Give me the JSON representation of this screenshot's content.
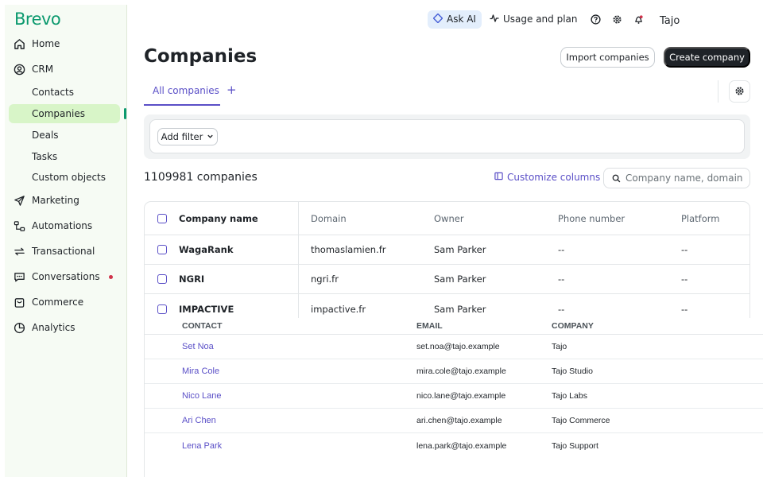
{
  "brand": {
    "logo": "Brevo"
  },
  "sidebar": {
    "items": [
      {
        "label": "Home",
        "icon": "home-icon"
      },
      {
        "label": "CRM",
        "icon": "user-circle-icon"
      },
      {
        "label": "Marketing",
        "icon": "send-icon"
      },
      {
        "label": "Automations",
        "icon": "automation-icon"
      },
      {
        "label": "Transactional",
        "icon": "repeat-icon"
      },
      {
        "label": "Conversations",
        "icon": "chat-icon"
      },
      {
        "label": "Commerce",
        "icon": "bag-icon"
      },
      {
        "label": "Analytics",
        "icon": "pie-chart-icon"
      }
    ],
    "crm_sub": [
      "Contacts",
      "Companies",
      "Deals",
      "Tasks",
      "Custom objects"
    ],
    "active_sub": "Companies"
  },
  "topbar": {
    "ask_ai": "Ask AI",
    "usage": "Usage and plan",
    "user": "Tajo"
  },
  "header": {
    "title": "Companies",
    "import_label": "Import companies",
    "create_label": "Create company"
  },
  "tabs": {
    "all": "All companies",
    "add": "+"
  },
  "filter": {
    "add_label": "Add filter"
  },
  "list": {
    "count": "1109981 companies",
    "customize": "Customize columns",
    "search_placeholder": "Company name, domain"
  },
  "table": {
    "columns": [
      "Company name",
      "Domain",
      "Owner",
      "Phone number",
      "Platform"
    ],
    "rows": [
      {
        "name": "WagaRank",
        "domain": "thomaslamien.fr",
        "owner": "Sam Parker",
        "phone": "--",
        "platform": "--"
      },
      {
        "name": "NGRI",
        "domain": "ngri.fr",
        "owner": "Sam Parker",
        "phone": "--",
        "platform": "--"
      },
      {
        "name": "IMPACTIVE",
        "domain": "impactive.fr",
        "owner": "Sam Parker",
        "phone": "--",
        "platform": "--"
      }
    ]
  },
  "contacts": {
    "columns": [
      "CONTACT",
      "EMAIL",
      "COMPANY"
    ],
    "rows": [
      {
        "contact": "Set Noa",
        "email": "set.noa@tajo.example",
        "company": "Tajo"
      },
      {
        "contact": "Mira Cole",
        "email": "mira.cole@tajo.example",
        "company": "Tajo Studio"
      },
      {
        "contact": "Nico Lane",
        "email": "nico.lane@tajo.example",
        "company": "Tajo Labs"
      },
      {
        "contact": "Ari Chen",
        "email": "ari.chen@tajo.example",
        "company": "Tajo Commerce"
      },
      {
        "contact": "Lena Park",
        "email": "lena.park@tajo.example",
        "company": "Tajo Support"
      }
    ]
  },
  "colors": {
    "brand": "#0b996e",
    "accent": "#5a4fc7",
    "active_bg": "#d8f5c8",
    "notify": "#d0334b"
  }
}
